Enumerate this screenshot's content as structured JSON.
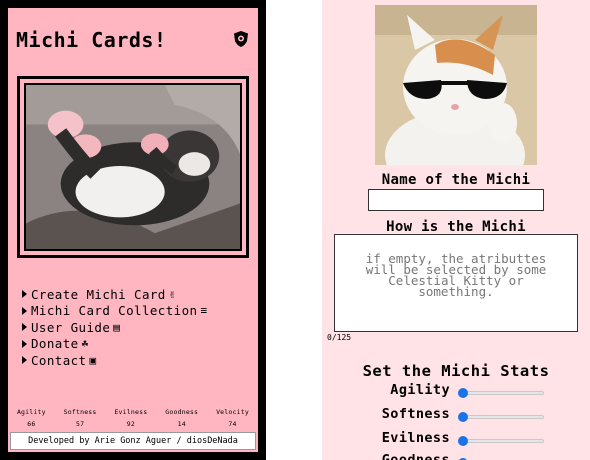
{
  "app": {
    "title": "Michi Cards!",
    "shield_icon": "shield-icon"
  },
  "menu": [
    {
      "label": "Create Michi Card",
      "icon": "glove-icon",
      "glyph": "✌"
    },
    {
      "label": "Michi Card Collection",
      "icon": "stack-icon",
      "glyph": "≡"
    },
    {
      "label": "User Guide",
      "icon": "book-icon",
      "glyph": "▤"
    },
    {
      "label": "Donate",
      "icon": "sprout-icon",
      "glyph": "☘"
    },
    {
      "label": "Contact",
      "icon": "contact-card-icon",
      "glyph": "▣"
    }
  ],
  "stats": [
    {
      "name": "Agility",
      "value": "66"
    },
    {
      "name": "Softness",
      "value": "57"
    },
    {
      "name": "Evilness",
      "value": "92"
    },
    {
      "name": "Goodness",
      "value": "14"
    },
    {
      "name": "Velocity",
      "value": "74"
    }
  ],
  "footer": "Developed by Arie Gonz Aguer / diosDeNada",
  "form": {
    "name_label": "Name of the Michi",
    "name_value": "",
    "description_label": "How is the Michi",
    "description_placeholder": "if empty, the atributtes will be selected by some Celestial Kitty or something.",
    "char_count": "0/125",
    "stats_title": "Set the Michi Stats",
    "sliders": [
      {
        "label": "Agility",
        "value": 0
      },
      {
        "label": "Softness",
        "value": 0
      },
      {
        "label": "Evilness",
        "value": 0
      },
      {
        "label": "Goodness",
        "value": 0
      }
    ]
  },
  "colors": {
    "panel_pink": "#ffb6c1",
    "form_pink": "#ffe3e7",
    "slider_accent": "#1a73e8"
  }
}
